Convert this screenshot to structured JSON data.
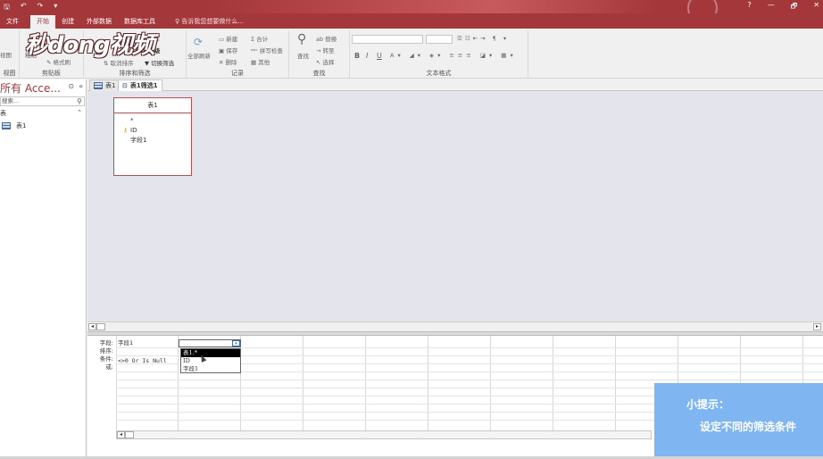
{
  "titlebar": {
    "qat": [
      "🖫",
      "↶",
      "↷",
      "▾"
    ],
    "controls": [
      "?",
      "—",
      "🗗",
      "✕"
    ]
  },
  "tabs": [
    "文件",
    "开始",
    "创建",
    "外部数据",
    "数据库工具"
  ],
  "tellme": "告诉我您想要做什么...",
  "watermark": "秒dong视频",
  "ribbon": {
    "groups": {
      "view": "视图",
      "clipboard": "剪贴板",
      "sort_filter": "排序和筛选",
      "records": "记录",
      "find": "查找",
      "text_format": "文本格式"
    },
    "view_btn": "视图",
    "paste_btn": "粘贴",
    "format_painter": "格式刷",
    "selection": "选择",
    "advanced": "高级",
    "toggle_filter": "切换筛选",
    "remove_sort": "取消排序",
    "refresh_all": "全部刷新",
    "new": "新建",
    "save": "保存",
    "delete": "删除",
    "totals": "合计",
    "spelling": "拼写检查",
    "more": "其他",
    "find_btn": "查找",
    "replace": "替换",
    "goto": "转至",
    "select": "选择",
    "bold": "B",
    "italic": "I",
    "underline": "U"
  },
  "nav": {
    "title": "所有 Acce...",
    "search_placeholder": "搜索...",
    "group": "表",
    "items": [
      {
        "label": "表1"
      }
    ]
  },
  "doctabs": [
    {
      "label": "表1"
    },
    {
      "label": "表1筛选1"
    }
  ],
  "tablebox": {
    "title": "表1",
    "fields": [
      "*",
      "ID",
      "字段1"
    ]
  },
  "grid": {
    "row_labels": [
      "字段:",
      "排序:",
      "条件:",
      "或:"
    ],
    "col1_field": "字段1",
    "col1_criteria": "<>0 Or Is Null",
    "dropdown_options": [
      "表1.*",
      "ID",
      "字段1"
    ]
  },
  "tip": {
    "title": "小提示：",
    "text": "设定不同的筛选条件"
  }
}
